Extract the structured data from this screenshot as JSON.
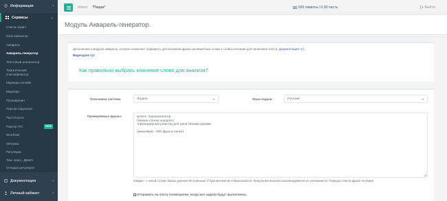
{
  "sidebar": {
    "sections": [
      {
        "label": "Информация"
      },
      {
        "label": "Сервисы"
      },
      {
        "label": "Документация"
      },
      {
        "label": "Личный кабинет"
      }
    ],
    "items": [
      {
        "label": "Список задач"
      },
      {
        "label": "Кластеризатор"
      },
      {
        "label": "Акварель"
      },
      {
        "label": "Акварель-генератор"
      },
      {
        "label": "Текстовый анализатор"
      },
      {
        "label": "Тематический"
      },
      {
        "label": "классификатор"
      },
      {
        "label": "Маркеры-онлайн"
      },
      {
        "label": "Маркеры"
      },
      {
        "label": "Расширения"
      },
      {
        "label": "Парсер подсказок"
      },
      {
        "label": "Частотность"
      },
      {
        "label": "Парсер ПС"
      },
      {
        "label": "WordStat"
      },
      {
        "label": "Метрика"
      },
      {
        "label": "Регулярки"
      },
      {
        "label": "Тем. класс. ДЕМО"
      },
      {
        "label": "Отладка регулярок"
      }
    ],
    "new_badge": "NEW"
  },
  "topbar": {
    "project_label": "Макет",
    "project_value": "\"Пацюк\"",
    "limit": "100 лимиты / 0,00 часть",
    "logout": "Выйти"
  },
  "page": {
    "title": "Модуль Акварель-генератор."
  },
  "intro": {
    "text": "Дополнение к модулю акварель, которое позволяет подбирать для ключевой фразы релевантные слова и словосочетания для написания текста.",
    "doc_link": "Документация тут.",
    "video": "Видеоурок тут.",
    "faq": "Как правильно выбрать ключевое слово для анализа?"
  },
  "form": {
    "search_engine_label": "Поисковая система",
    "search_engine_value": "Яндекс",
    "language_label": "Язык задачи",
    "language_value": "Русский",
    "phrases_label": "Проверяемые фразы:",
    "phrases_lines": [
      "купить трансклюкатор",
      "боевые слоны недорого",
      "термоядерный реактор для дачи своими руками",
      "...",
      "(максимум - 500 фраз в пачке)"
    ],
    "help_text": "Каждая - с новой строки. Фразы длиннее 50 и меньше 3 букв автоматом отбрасываются. Предлоги/союзы/частицы/междометия не учитываются. Порядок слов во фразе не важен.",
    "notify_label": "Отправить на почту оповещение, когда все задачи будут выполнены."
  },
  "colors": {
    "accent": "#1ab394",
    "sidebar": "#2f4050",
    "link": "#3a5e9a"
  }
}
